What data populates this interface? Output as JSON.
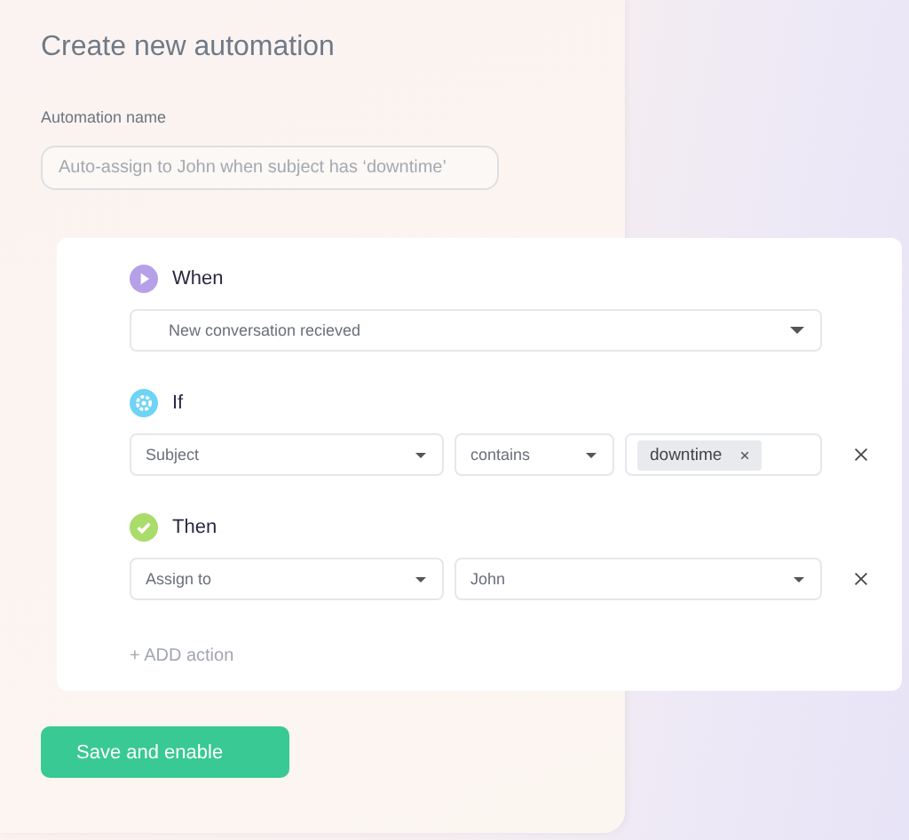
{
  "title": "Create new automation",
  "name_field": {
    "label": "Automation name",
    "placeholder": "Auto-assign to John when subject has ‘downtime’"
  },
  "sections": [
    {
      "kind": "trigger",
      "title": "When",
      "removable": false,
      "fields": [
        {
          "kind": "select",
          "value": "New conversation recieved"
        }
      ]
    },
    {
      "kind": "condition",
      "title": "If",
      "removable": true,
      "fields": [
        {
          "kind": "select",
          "value": "Subject"
        },
        {
          "kind": "select",
          "value": "contains"
        },
        {
          "kind": "tags",
          "tags": [
            "downtime"
          ]
        }
      ]
    },
    {
      "kind": "action",
      "title": "Then",
      "removable": true,
      "fields": [
        {
          "kind": "select",
          "value": "Assign to"
        },
        {
          "kind": "select",
          "value": "John"
        }
      ]
    }
  ],
  "add_action": "+ ADD action",
  "save_button": "Save and enable"
}
